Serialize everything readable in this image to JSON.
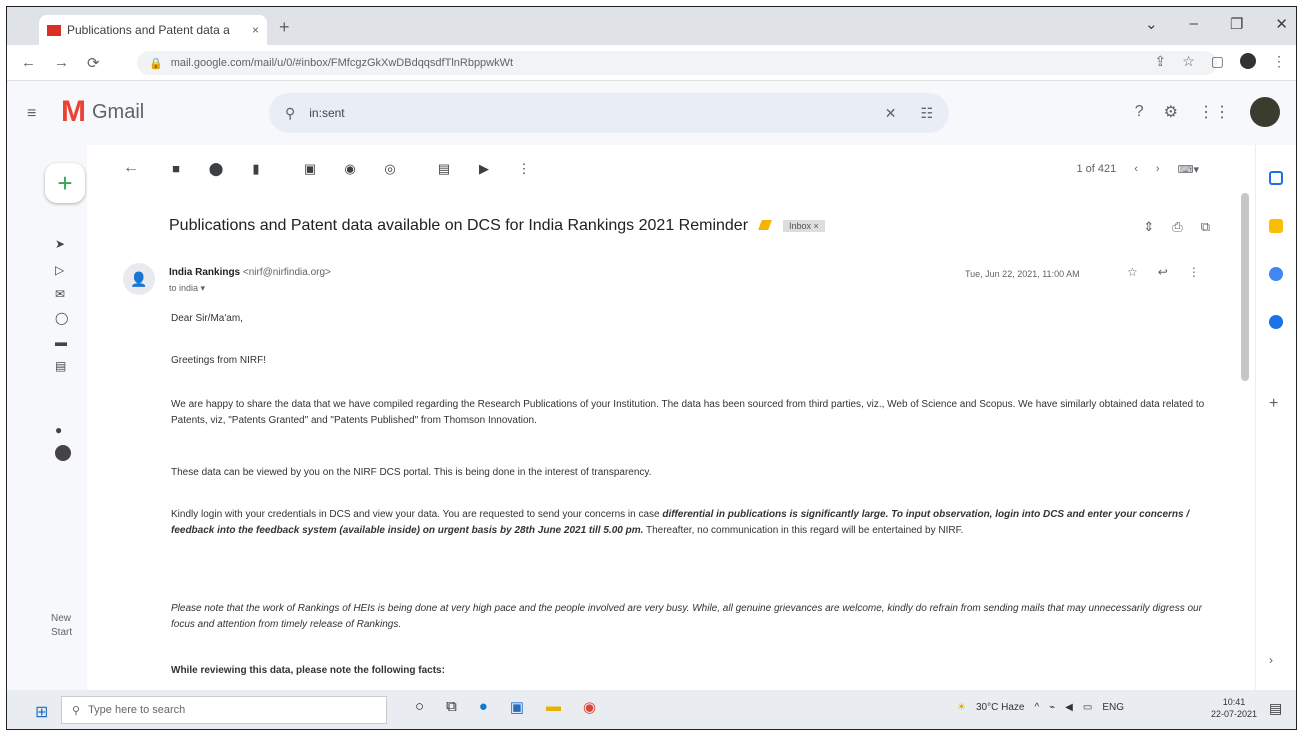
{
  "browser": {
    "tab_title": "Publications and Patent data a",
    "tab_close": "×",
    "new_tab": "+",
    "url": "mail.google.com/mail/u/0/#inbox/FMfcgzGkXwDBdqqsdfTlnRbppwkWt",
    "nav": {
      "back": "←",
      "forward": "→",
      "reload": "⟳"
    }
  },
  "gmail": {
    "logo_letter": "M",
    "logo_word": "Gmail",
    "search_value": "in:sent",
    "toolbar": {
      "pager": "1 of 421"
    }
  },
  "email": {
    "subject": "Publications and Patent data available on DCS for India Rankings 2021 Reminder",
    "label": "Inbox ×",
    "sender_name": "India Rankings",
    "sender_email": "<nirf@nirfindia.org>",
    "to": "to india ▾",
    "date": "Tue, Jun 22, 2021, 11:00 AM",
    "greeting": "Dear Sir/Ma'am,",
    "p1": "Greetings from NIRF!",
    "p2": "We are happy to share the data that we have compiled regarding the Research Publications of your Institution. The data has been sourced from third parties, viz., Web of Science and Scopus. We have similarly obtained data related to Patents, viz, \"Patents Granted\" and \"Patents Published\" from Thomson Innovation.",
    "p3": "These data can be viewed by you on the NIRF DCS portal. This is being done in the interest of transparency.",
    "p4a": "Kindly login with your credentials in DCS and view your data. You are requested to send your concerns in case ",
    "p4b": "differential in publications is significantly large. To input observation, login into DCS and enter your concerns / feedback into the feedback system (available inside) on urgent basis by 28th June 2021 till 5.00 pm.",
    "p4c": " Thereafter, no communication in this regard will be entertained by NIRF.",
    "p5": "Please note that the work of Rankings of HEIs is being done at very high pace and the people involved are very busy. While, all genuine grievances are welcome, kindly do refrain from sending mails that may unnecessarily digress our focus and attention from timely release of Rankings.",
    "p6": "While reviewing this data, please note the following facts:"
  },
  "rail": {
    "meet_line1": "New",
    "meet_line2": "Start"
  },
  "taskbar": {
    "search_placeholder": "Type here to search",
    "weather": "30°C  Haze",
    "lang": "ENG",
    "time": "10:41",
    "date": "22-07-2021"
  }
}
